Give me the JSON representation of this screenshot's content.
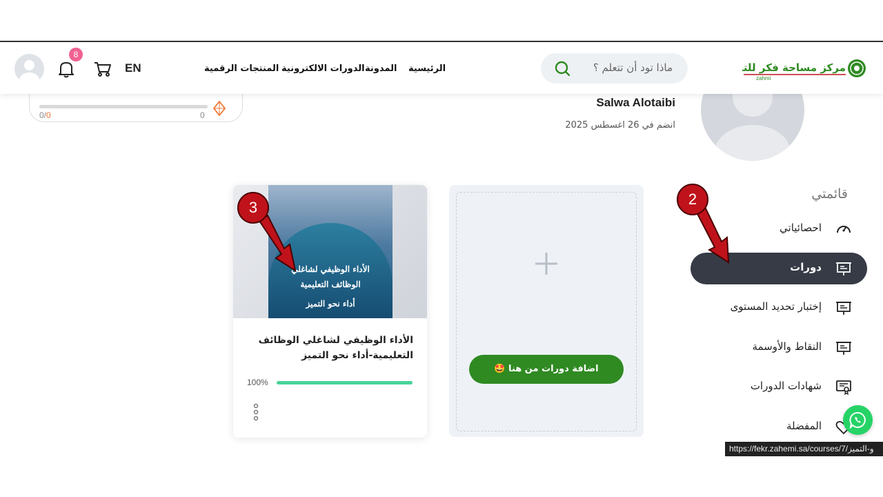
{
  "header": {
    "nav": [
      "الرئيسية",
      "المدونة",
      "الدورات الالكترونية",
      "المنتجات الرقمية"
    ],
    "search_placeholder": "ماذا تود أن تتعلم ؟",
    "lang": "EN",
    "notification_count": "8",
    "logo_text": "مركز مساحة فكر للتدريب",
    "logo_sub": "zahmi"
  },
  "progress": {
    "left_current": "0",
    "left_sep": "/",
    "left_total": "0",
    "right_value": "0"
  },
  "profile": {
    "name": "Salwa Alotaibi",
    "joined": "انضم في 26 اغسطس 2025"
  },
  "sidebar": {
    "title": "قائمتي",
    "items": [
      {
        "label": "احصائياتي",
        "icon": "speedometer-icon"
      },
      {
        "label": "دورات",
        "icon": "presentation-board-icon",
        "active": true
      },
      {
        "label": "إختبار تحديد المستوى",
        "icon": "presentation-board-icon"
      },
      {
        "label": "النقاط والأوسمة",
        "icon": "presentation-board-icon"
      },
      {
        "label": "شهادات الدورات",
        "icon": "certificate-icon"
      },
      {
        "label": "المفضلة",
        "icon": "heart-icon"
      }
    ]
  },
  "add_course": {
    "button_label": "اضافة دورات من هنا 🤩"
  },
  "course": {
    "thumb_line1": "الأداء الوظيفي لشاغلي",
    "thumb_line2": "الوظائف التعليمية",
    "thumb_line3": "أداء نحو التميز",
    "title": "الأداء الوظيفي لشاغلي الوظائف التعليمية-أداء نحو التميز",
    "progress_label": "100%",
    "progress": 1.0
  },
  "url_tooltip": "https://fekr.zahemi.sa/courses/7/و-التميز",
  "annotations": {
    "callout_2": "2",
    "callout_3": "3"
  },
  "colors": {
    "accent_green": "#2f8a22",
    "active_item": "#363b46",
    "progress_fill": "#48d49a",
    "callout_red": "#c0121b"
  }
}
